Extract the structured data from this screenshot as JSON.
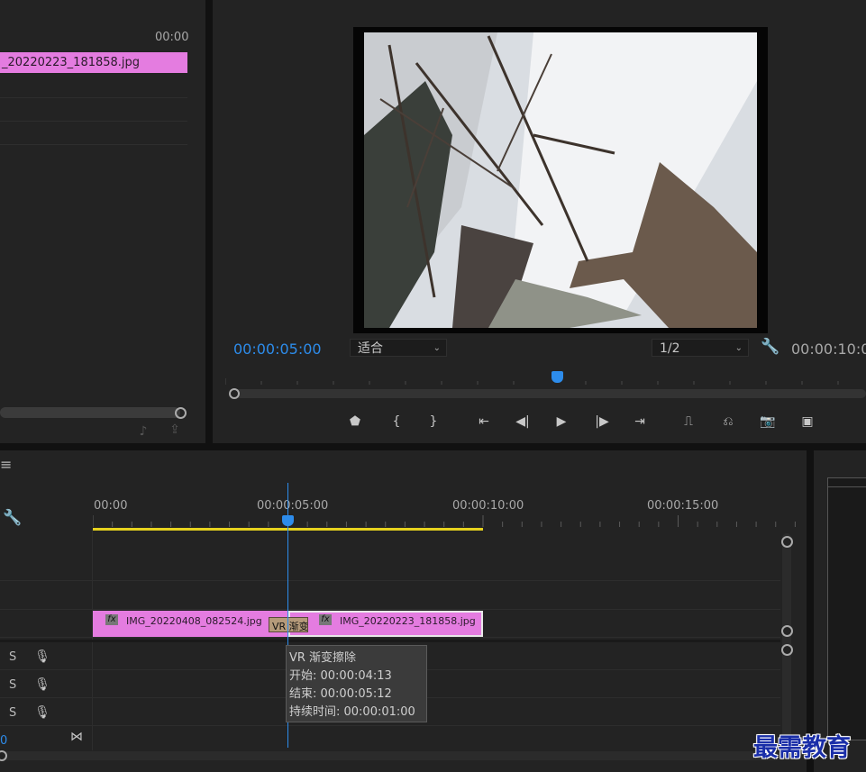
{
  "source_panel": {
    "timecode_header": "00:00",
    "clip_label": "_20220223_181858.jpg"
  },
  "program_monitor": {
    "current_time": "00:00:05:00",
    "fit_label": "适合",
    "resolution_label": "1/2",
    "duration": "00:00:10:0"
  },
  "transport": {
    "buttons": [
      "add-marker",
      "mark-in",
      "mark-out",
      "go-to-in",
      "step-back",
      "play",
      "step-forward",
      "go-to-out",
      "lift",
      "extract",
      "export-frame",
      "compare-view"
    ]
  },
  "timeline": {
    "menu_icon": "≡",
    "ruler_labels": [
      "00:00",
      "00:00:05:00",
      "00:00:10:00",
      "00:00:15:00"
    ],
    "clips": [
      {
        "name": "IMG_20220408_082524.jpg",
        "fx": "fx"
      },
      {
        "name": "IMG_20220223_181858.jpg",
        "fx": "fx"
      }
    ],
    "transition_label": "VR 渐变",
    "audio_tracks": [
      {
        "solo": "S"
      },
      {
        "solo": "S"
      },
      {
        "solo": "S"
      }
    ],
    "master_value": "0",
    "tooltip": {
      "title": "VR 渐变擦除",
      "start": "开始: 00:00:04:13",
      "end": "结束: 00:00:05:12",
      "duration": "持续时间: 00:00:01:00"
    }
  },
  "watermark": "最需教育",
  "colors": {
    "accent_blue": "#2d8ceb",
    "clip_pink": "#e47ce0",
    "in_out_bar": "#e6d21e",
    "transition": "#b59a7a",
    "watermark": "#1a2ea8"
  }
}
